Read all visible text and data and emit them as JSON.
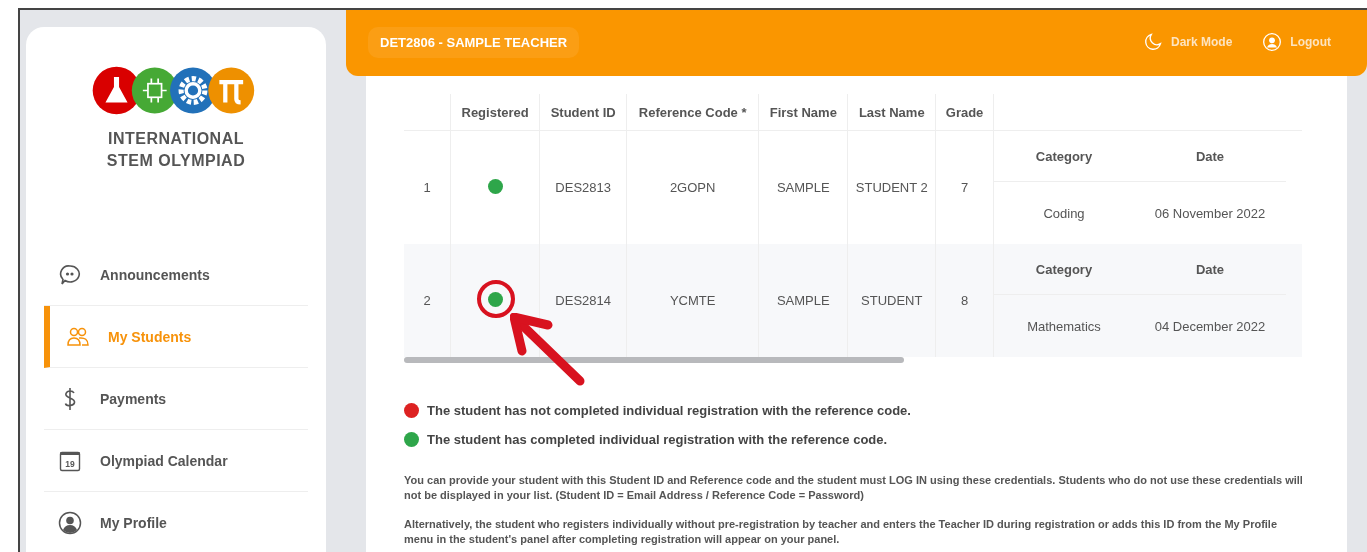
{
  "logo": {
    "line_1": "INTERNATIONAL",
    "line_2": "STEM OLYMPIAD"
  },
  "sidebar": {
    "items": [
      {
        "label": "Announcements",
        "selected": false
      },
      {
        "label": "My Students",
        "selected": true
      },
      {
        "label": "Payments",
        "selected": false
      },
      {
        "label": "Olympiad Calendar",
        "calendar_day": "19",
        "selected": false
      },
      {
        "label": "My Profile",
        "selected": false
      }
    ]
  },
  "header": {
    "teacher": "DET2806 - SAMPLE TEACHER",
    "dark_mode": "Dark Mode",
    "logout": "Logout"
  },
  "table": {
    "columns": [
      "",
      "Registered",
      "Student ID",
      "Reference Code *",
      "First Name",
      "Last Name",
      "Grade"
    ],
    "rows": [
      {
        "number": "1",
        "category_header": "Category",
        "date_header": "Date",
        "registered": true,
        "student_id": "DES2813",
        "reference_code": "2GOPN",
        "first_name": "SAMPLE",
        "last_name": "STUDENT 2",
        "grade": "7",
        "category": "Coding",
        "date": "06 November 2022"
      },
      {
        "number": "2",
        "category_header": "Category",
        "date_header": "Date",
        "registered": true,
        "student_id": "DES2814",
        "reference_code": "YCMTE",
        "first_name": "SAMPLE",
        "last_name": "STUDENT",
        "grade": "8",
        "category": "Mathematics",
        "date": "04 December 2022"
      }
    ]
  },
  "legend": [
    {
      "text": "The student has not completed individual registration with the reference code.",
      "color": "#dd2222"
    },
    {
      "text": "The student has completed individual registration with the reference code.",
      "color": "#2ea64a"
    }
  ],
  "notes": [
    "You can provide your student with this Student ID and Reference code and the student must LOG IN using these credentials. Students who do not use these credentials will not be displayed in your list. (Student ID = Email Address / Reference Code = Password)",
    "Alternatively, the student who registers individually without pre-registration by teacher and enters the Teacher ID during registration or adds this ID from the My Profile menu in the student's panel after completing registration will appear on your panel."
  ]
}
